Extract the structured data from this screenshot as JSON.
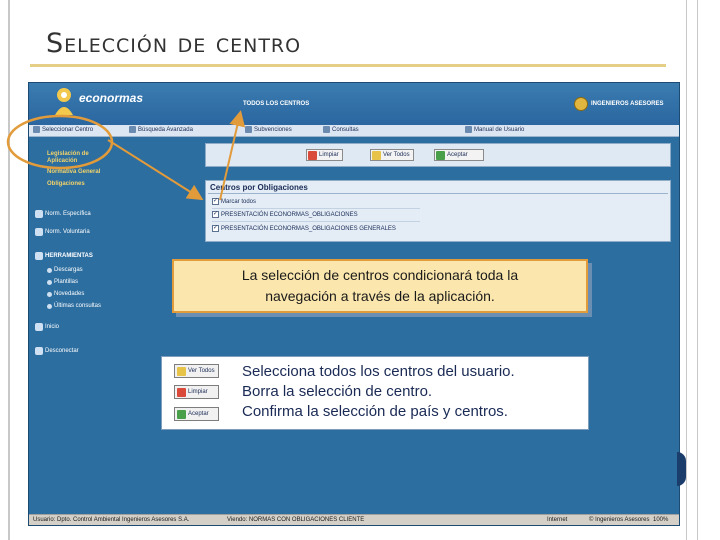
{
  "slide": {
    "title": "Selección de centro"
  },
  "app": {
    "logo_text": "econormas",
    "header_section": "TODOS LOS CENTROS",
    "brand_text": "INGENIEROS ASESORES",
    "menu": {
      "seleccionar_centro": "Seleccionar Centro",
      "busqueda_avanzada": "Búsqueda Avanzada",
      "subvenciones": "Subvenciones",
      "consultas": "Consultas",
      "manual_usuario": "Manual de Usuario"
    },
    "sidebar": {
      "legislacion_aplicacion": "Legislación de Aplicación",
      "normativa_general": "Normativa General",
      "obligaciones": "Obligaciones",
      "norm_especifica": "Norm. Específica",
      "norm_voluntaria": "Norm. Voluntaria",
      "herramientas": "HERRAMIENTAS",
      "descargas": "Descargas",
      "plantillas": "Plantillas",
      "novedades": "Novedades",
      "ultimas_consultas": "Últimas consultas",
      "inicio": "Inicio",
      "desconectar": "Desconectar"
    },
    "actions": {
      "limpiar": "Limpiar",
      "ver_todos": "Ver Todos",
      "aceptar": "Aceptar"
    },
    "panel": {
      "title": "Centros por Obligaciones",
      "options": [
        "Marcar todos",
        "PRESENTACIÓN ECONORMAS_OBLIGACIONES",
        "PRESENTACIÓN ECONORMAS_OBLIGACIONES GENERALES"
      ]
    },
    "statusbar": {
      "usuario": "Usuario: Dpto. Control Ambiental Ingenieros Asesores S.A.",
      "viendo": "Viendo: NORMAS CON OBLIGACIONES CLIENTE",
      "internet": "Internet",
      "copyright": "© Ingenieros Asesores",
      "zoom": "100%"
    }
  },
  "callouts": {
    "navigation_note_line1": "La selección de centros condicionará toda la",
    "navigation_note_line2": "navegación a través de la aplicación.",
    "legend": {
      "ver_todos_btn": "Ver Todos",
      "limpiar_btn": "Limpiar",
      "aceptar_btn": "Aceptar",
      "ver_todos_desc": "Selecciona todos los centros del usuario.",
      "limpiar_desc": "Borra la selección de centro.",
      "aceptar_desc": "Confirma la selección de país y centros."
    }
  },
  "colors": {
    "app_blue": "#2d6ea0",
    "accent_orange": "#e29b3a",
    "callout_yellow": "#fbe7ad",
    "title_rule": "#e5cf86"
  }
}
